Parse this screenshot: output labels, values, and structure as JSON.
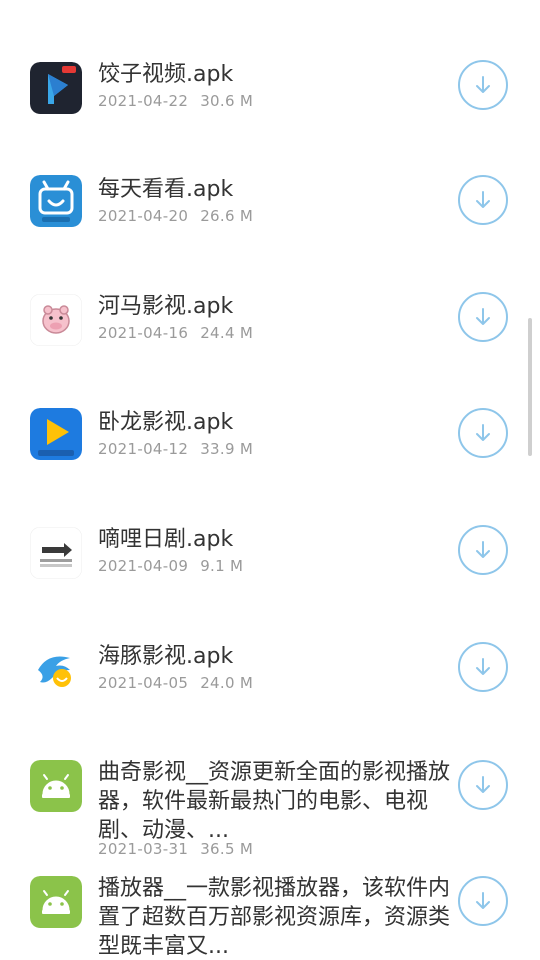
{
  "apps": [
    {
      "name": "饺子视频.apk",
      "date": "2021-04-22",
      "size": "30.6 M",
      "icon": "jiaozi-video-icon"
    },
    {
      "name": "每天看看.apk",
      "date": "2021-04-20",
      "size": "26.6 M",
      "icon": "meitian-kankan-icon"
    },
    {
      "name": "河马影视.apk",
      "date": "2021-04-16",
      "size": "24.4 M",
      "icon": "hippo-video-icon"
    },
    {
      "name": "卧龙影视.apk",
      "date": "2021-04-12",
      "size": "33.9 M",
      "icon": "wolong-video-icon"
    },
    {
      "name": "嘀哩日剧.apk",
      "date": "2021-04-09",
      "size": "9.1 M",
      "icon": "dili-drama-icon"
    },
    {
      "name": "海豚影视.apk",
      "date": "2021-04-05",
      "size": "24.0 M",
      "icon": "dolphin-video-icon"
    },
    {
      "name": "曲奇影视__资源更新全面的影视播放器，软件最新最热门的电影、电视剧、动漫、...",
      "date": "2021-03-31",
      "size": "36.5 M",
      "icon": "android-icon"
    },
    {
      "name": "播放器__一款影视播放器，该软件内置了超数百万部影视资源库，资源类型既丰富又...",
      "date": "",
      "size": "",
      "icon": "android-icon"
    }
  ],
  "colors": {
    "accent": "#8ec6ea",
    "title_text": "#333333",
    "meta_text": "#9a9a9a",
    "android_green": "#8bc34a"
  }
}
